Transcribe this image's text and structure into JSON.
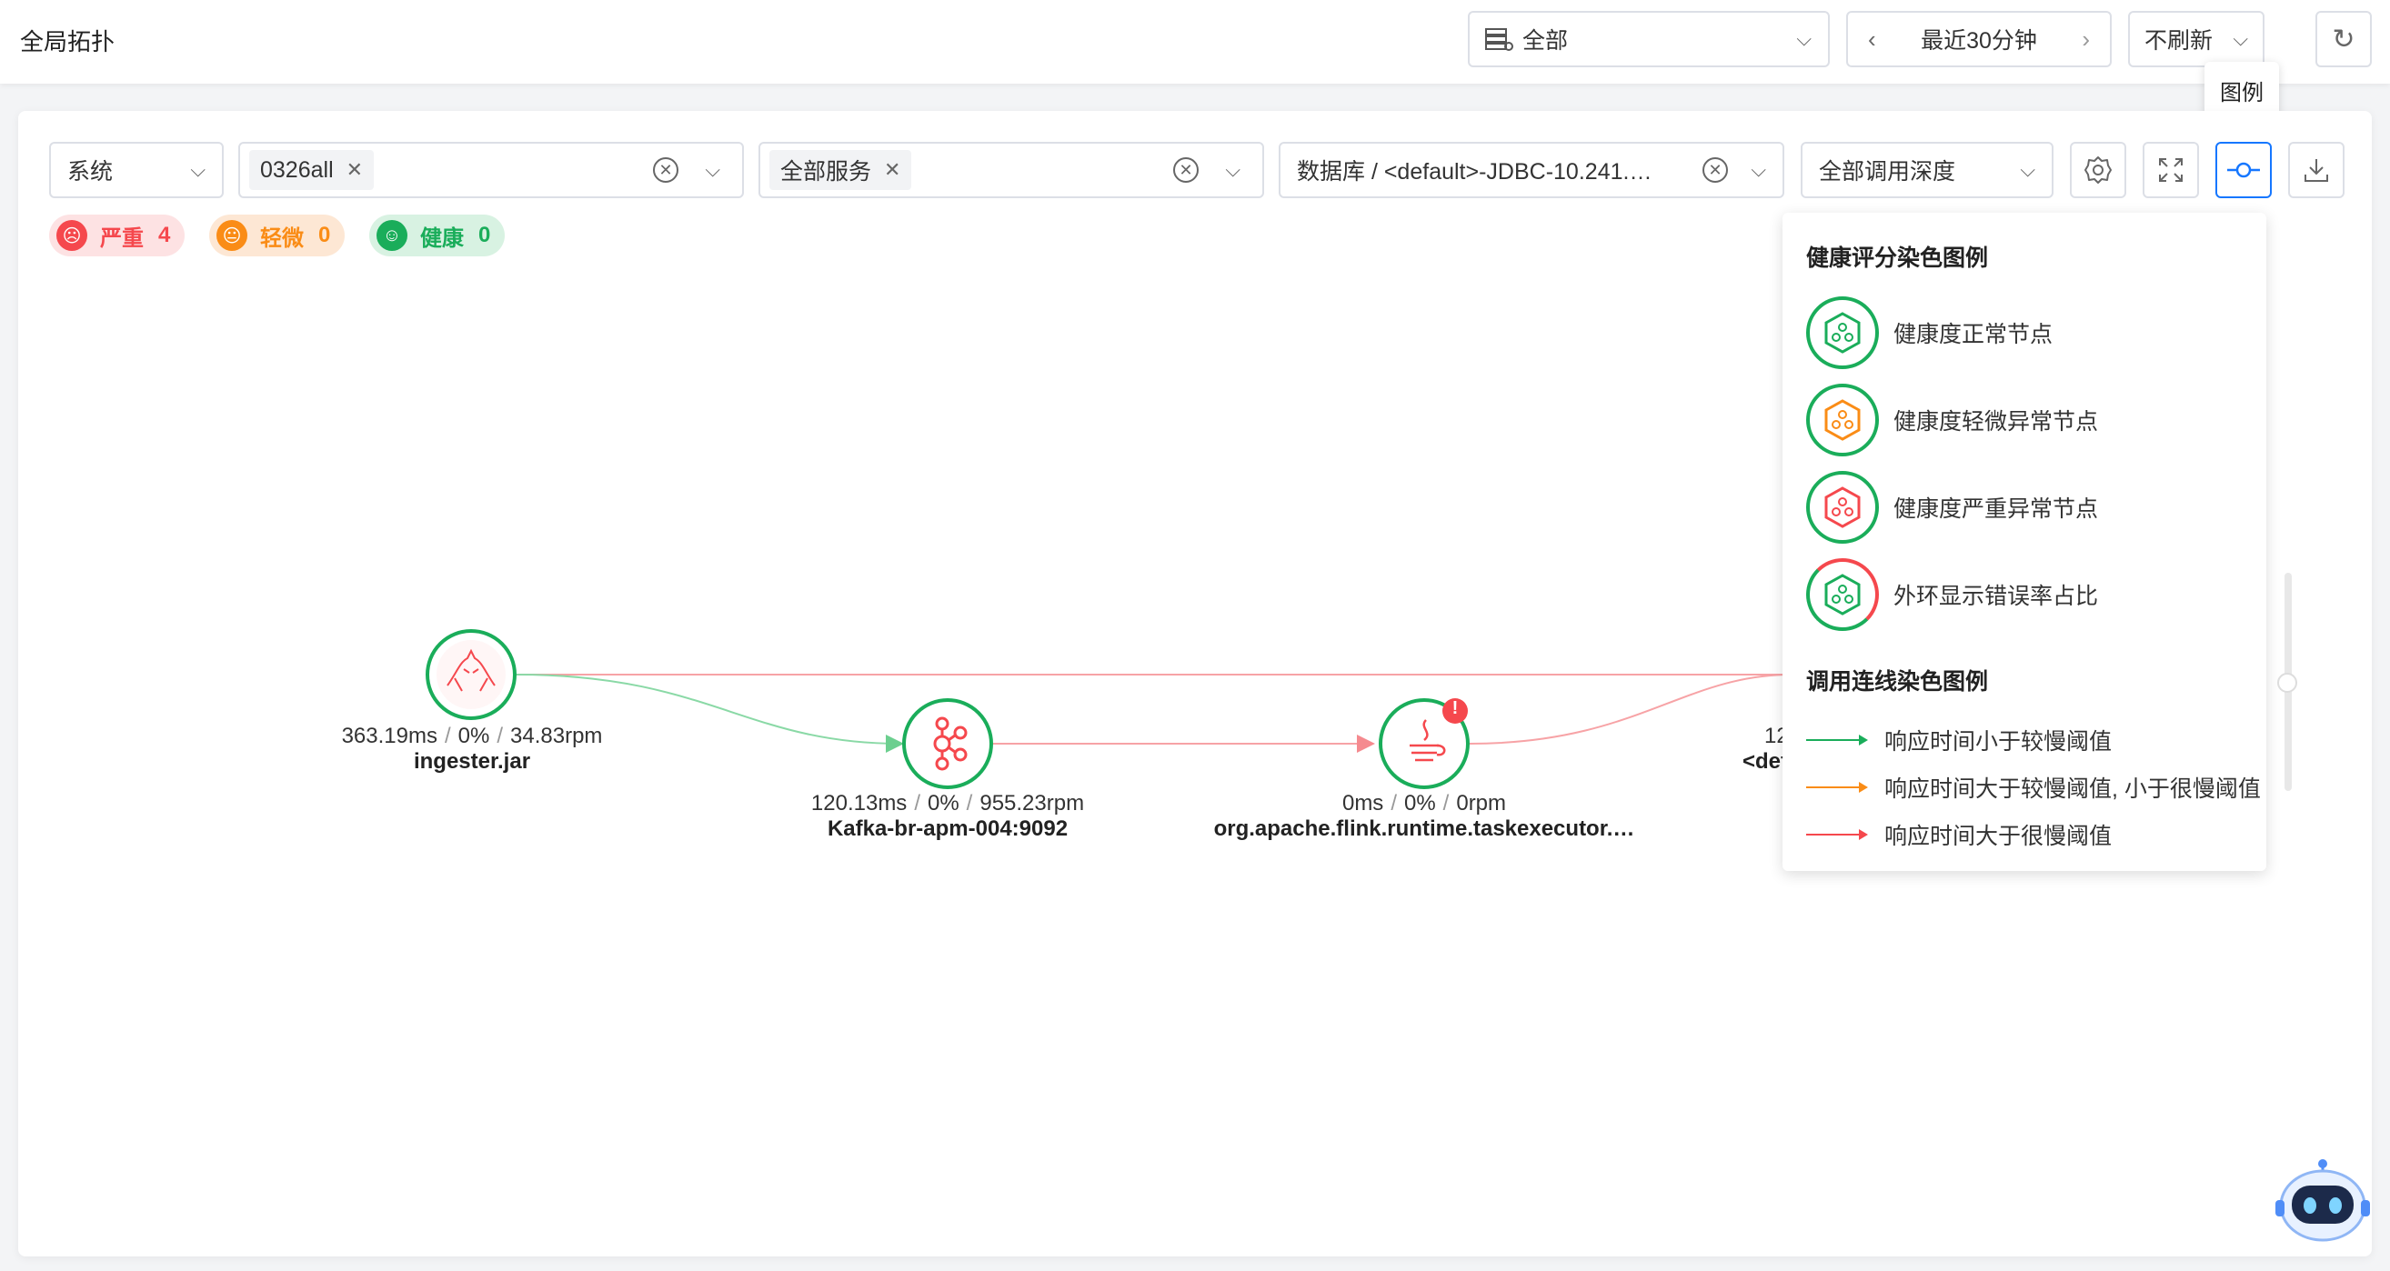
{
  "header": {
    "title": "全局拓扑",
    "scope_select": "全部",
    "time_range": "最近30分钟",
    "refresh_select": "不刷新"
  },
  "filters": {
    "system_select": "系统",
    "tag_value": "0326all",
    "service_tag": "全部服务",
    "database_select": "数据库 / <default>-JDBC-10.241.…",
    "depth_select": "全部调用深度"
  },
  "tooltip": {
    "text": "图例"
  },
  "status_pills": [
    {
      "label": "严重",
      "count": "4",
      "color": "#f5484d"
    },
    {
      "label": "轻微",
      "count": "0",
      "color": "#fa8c16"
    },
    {
      "label": "健康",
      "count": "0",
      "color": "#1aad5a"
    }
  ],
  "nodes": [
    {
      "metrics": [
        "363.19ms",
        "0%",
        "34.83rpm"
      ],
      "name": "ingester.jar",
      "icon": "tomcat-icon"
    },
    {
      "metrics": [
        "120.13ms",
        "0%",
        "955.23rpm"
      ],
      "name": "Kafka-br-apm-004:9092",
      "icon": "kafka-icon"
    },
    {
      "metrics": [
        "0ms",
        "0%",
        "0rpm"
      ],
      "name": "org.apache.flink.runtime.taskexecutor.…",
      "icon": "java-icon",
      "badge": "!"
    },
    {
      "metric_partial": "12",
      "name_partial": "<def"
    }
  ],
  "legend": {
    "health_title": "健康评分染色图例",
    "health_items": [
      {
        "label": "健康度正常节点",
        "color": "#1aad5a"
      },
      {
        "label": "健康度轻微异常节点",
        "color": "#fa8c16"
      },
      {
        "label": "健康度严重异常节点",
        "color": "#f5484d"
      },
      {
        "label": "外环显示错误率占比",
        "color": "#1aad5a"
      }
    ],
    "line_title": "调用连线染色图例",
    "line_items": [
      {
        "label": "响应时间小于较慢阈值",
        "color": "#1aad5a"
      },
      {
        "label": "响应时间大于较慢阈值, 小于很慢阈值",
        "color": "#fa8c16"
      },
      {
        "label": "响应时间大于很慢阈值",
        "color": "#f5484d"
      }
    ]
  }
}
